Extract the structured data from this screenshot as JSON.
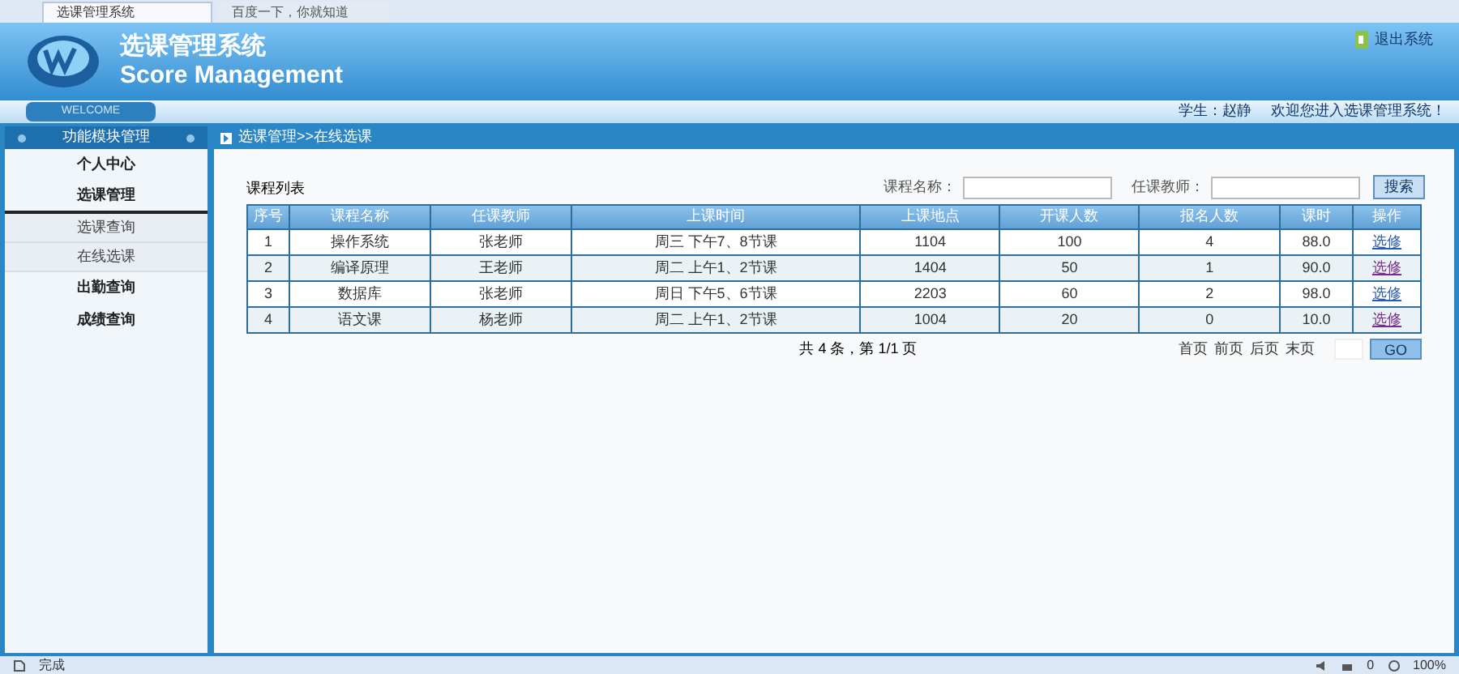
{
  "browser_tabs": [
    {
      "label": "选课管理系统",
      "selected": true
    },
    {
      "label": "百度一下，你就知道",
      "selected": false
    }
  ],
  "header": {
    "title": "选课管理系统",
    "subtitle": "Score Management",
    "logout": "退出系统"
  },
  "welcome_bar": {
    "welcome": "WELCOME",
    "user": "学生：赵静",
    "greeting": "欢迎您进入选课管理系统！"
  },
  "sidebar": {
    "title": "功能模块管理",
    "items": [
      {
        "label": "个人中心",
        "expanded": false
      },
      {
        "label": "选课管理",
        "expanded": true,
        "children": [
          {
            "label": "选课查询"
          },
          {
            "label": "在线选课"
          }
        ]
      },
      {
        "label": "出勤查询",
        "expanded": false
      },
      {
        "label": "成绩查询",
        "expanded": false
      }
    ]
  },
  "breadcrumb": "选课管理>>在线选课",
  "list_title": "课程列表",
  "search": {
    "course_label": "课程名称：",
    "teacher_label": "任课教师：",
    "button": "搜索"
  },
  "table": {
    "columns": [
      "序号",
      "课程名称",
      "任课教师",
      "上课时间",
      "上课地点",
      "开课人数",
      "报名人数",
      "课时",
      "操作"
    ],
    "rows": [
      {
        "cells": [
          "1",
          "操作系统",
          "张老师",
          "周三 下午7、8节课",
          "1104",
          "100",
          "4",
          "88.0"
        ],
        "action": "选修",
        "visited": false
      },
      {
        "cells": [
          "2",
          "编译原理",
          "王老师",
          "周二 上午1、2节课",
          "1404",
          "50",
          "1",
          "90.0"
        ],
        "action": "选修",
        "visited": true
      },
      {
        "cells": [
          "3",
          "数据库",
          "张老师",
          "周日 下午5、6节课",
          "2203",
          "60",
          "2",
          "98.0"
        ],
        "action": "选修",
        "visited": false
      },
      {
        "cells": [
          "4",
          "语文课",
          "杨老师",
          "周二 上午1、2节课",
          "1004",
          "20",
          "0",
          "10.0"
        ],
        "action": "选修",
        "visited": true
      }
    ]
  },
  "pagination": {
    "summary": "共 4 条，第 1/1 页",
    "links": [
      "首页",
      "前页",
      "后页",
      "末页"
    ],
    "go": "GO"
  },
  "status_bar": {
    "text": "完成",
    "count": "0",
    "zoom": "100%"
  }
}
